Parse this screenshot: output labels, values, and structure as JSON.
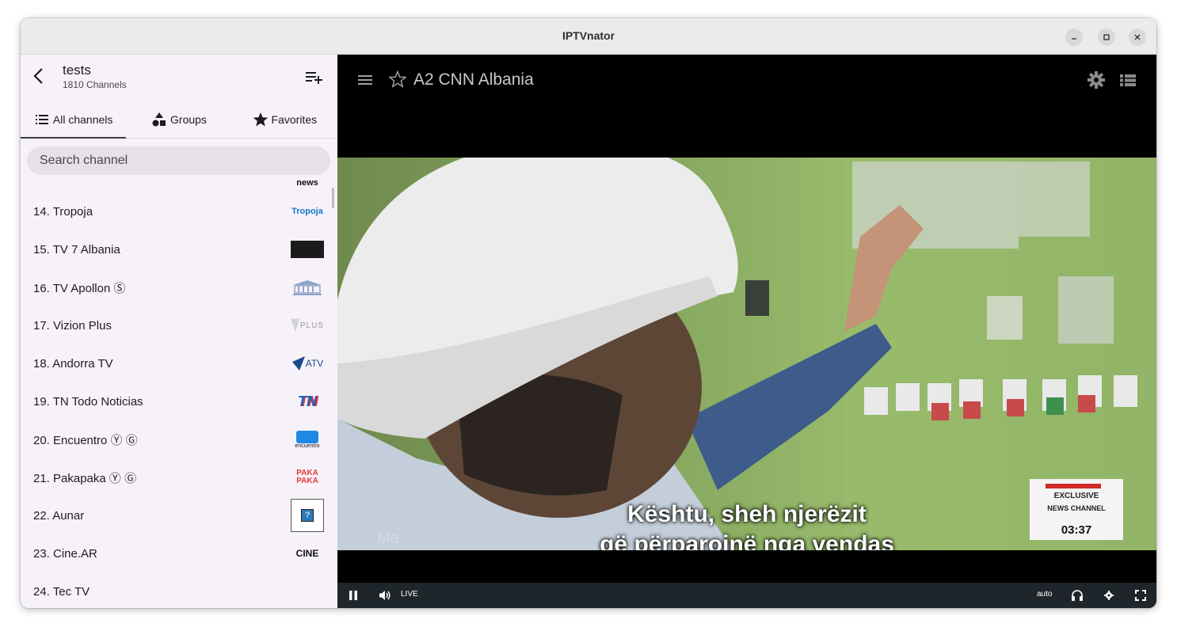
{
  "window": {
    "title": "IPTVnator"
  },
  "sidebar": {
    "playlist_name": "tests",
    "channel_count": "1810 Channels",
    "tabs": [
      {
        "label": "All channels",
        "icon": "list-icon",
        "active": true
      },
      {
        "label": "Groups",
        "icon": "shapes-icon",
        "active": false
      },
      {
        "label": "Favorites",
        "icon": "star-icon",
        "active": false
      }
    ],
    "search_placeholder": "Search channel",
    "channels": [
      {
        "label": "14. Tropoja",
        "logo": "Tropoja"
      },
      {
        "label": "15. TV 7 Albania",
        "logo": "tv7"
      },
      {
        "label": "16. TV Apollon Ⓢ",
        "logo": "apollon"
      },
      {
        "label": "17. Vizion Plus",
        "logo": "PLUS"
      },
      {
        "label": "18. Andorra TV",
        "logo": "ATV"
      },
      {
        "label": "19. TN Todo Noticias",
        "logo": "TN"
      },
      {
        "label": "20. Encuentro Ⓨ Ⓖ",
        "logo": "encuentro"
      },
      {
        "label": "21. Pakapaka Ⓨ Ⓖ",
        "logo": "PAKA PAKA"
      },
      {
        "label": "22. Aunar",
        "logo": "?"
      },
      {
        "label": "23. Cine.AR",
        "logo": "CINE"
      },
      {
        "label": "24. Tec TV",
        "logo": ""
      }
    ]
  },
  "player": {
    "channel_title": "A2 CNN Albania",
    "subtitle_line1": "Kështu, sheh njerëzit",
    "subtitle_line2": "që përparojnë nga vendas",
    "badge_line1": "EXCLUSIVE",
    "badge_line2": "NEWS CHANNEL",
    "badge_time": "03:37",
    "watermark": "Ma",
    "live_label": "LIVE",
    "quality_label": "auto"
  },
  "colors": {
    "sidebar_bg": "#f7f2fa",
    "search_bg": "#e6e0e9",
    "player_bg": "#000000",
    "controls_bg": "#1f262b"
  }
}
